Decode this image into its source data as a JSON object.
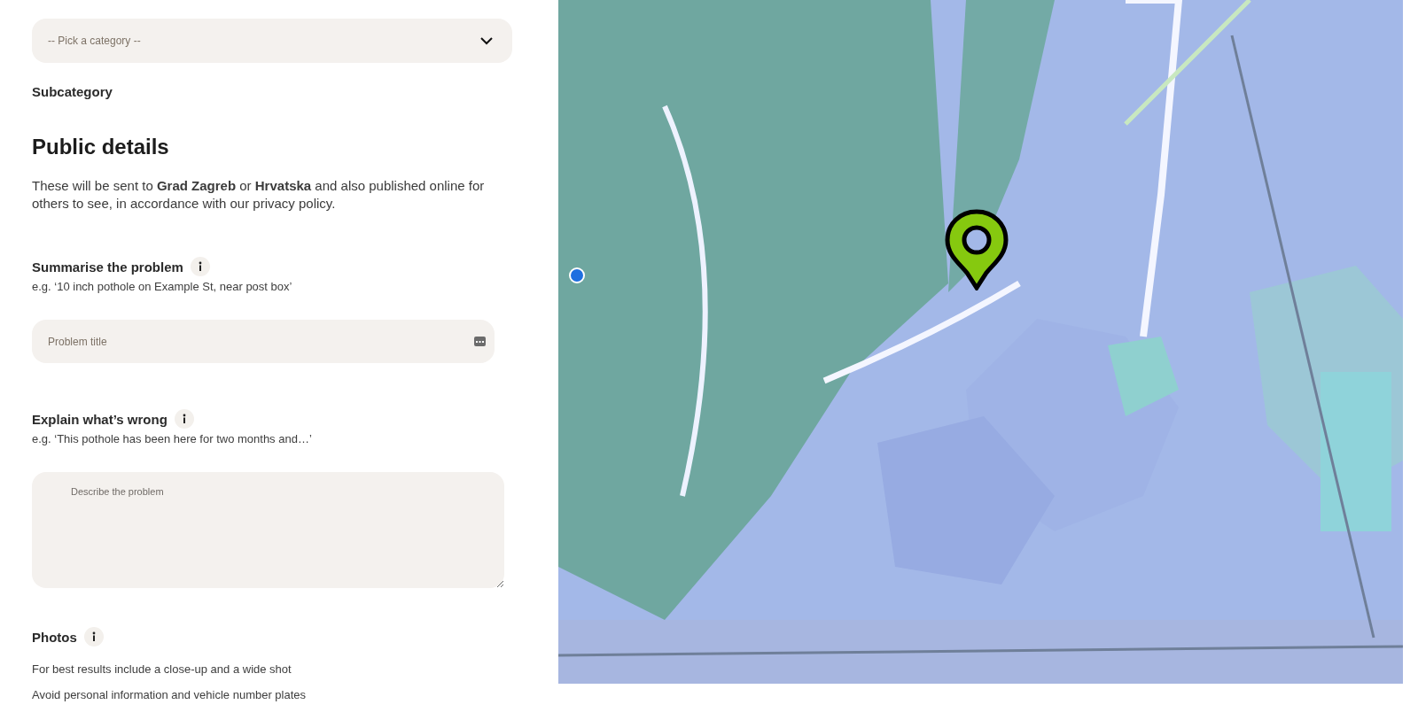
{
  "category_select": {
    "placeholder": "-- Pick a category --"
  },
  "subcategory_label": "Subcategory",
  "section_title": "Public details",
  "intro": "These will be sent to **Grad Zagreb** or **Hrvatska** and also published online for others to see, in accordance with our privacy policy.",
  "fields": [
    {
      "kind": "input",
      "label": "Summarise the problem",
      "hint": "e.g. ‘10 inch pothole on Example St, near post box’",
      "placeholder": "Problem title"
    },
    {
      "kind": "textarea",
      "label": "Explain what’s wrong",
      "hint": "e.g. ‘This pothole has been here for two months and…’",
      "placeholder": "Describe the problem"
    }
  ],
  "photos": {
    "label": "Photos",
    "notes": [
      "For best results include a close-up and a wide shot",
      "Avoid personal information and vehicle number plates"
    ]
  }
}
